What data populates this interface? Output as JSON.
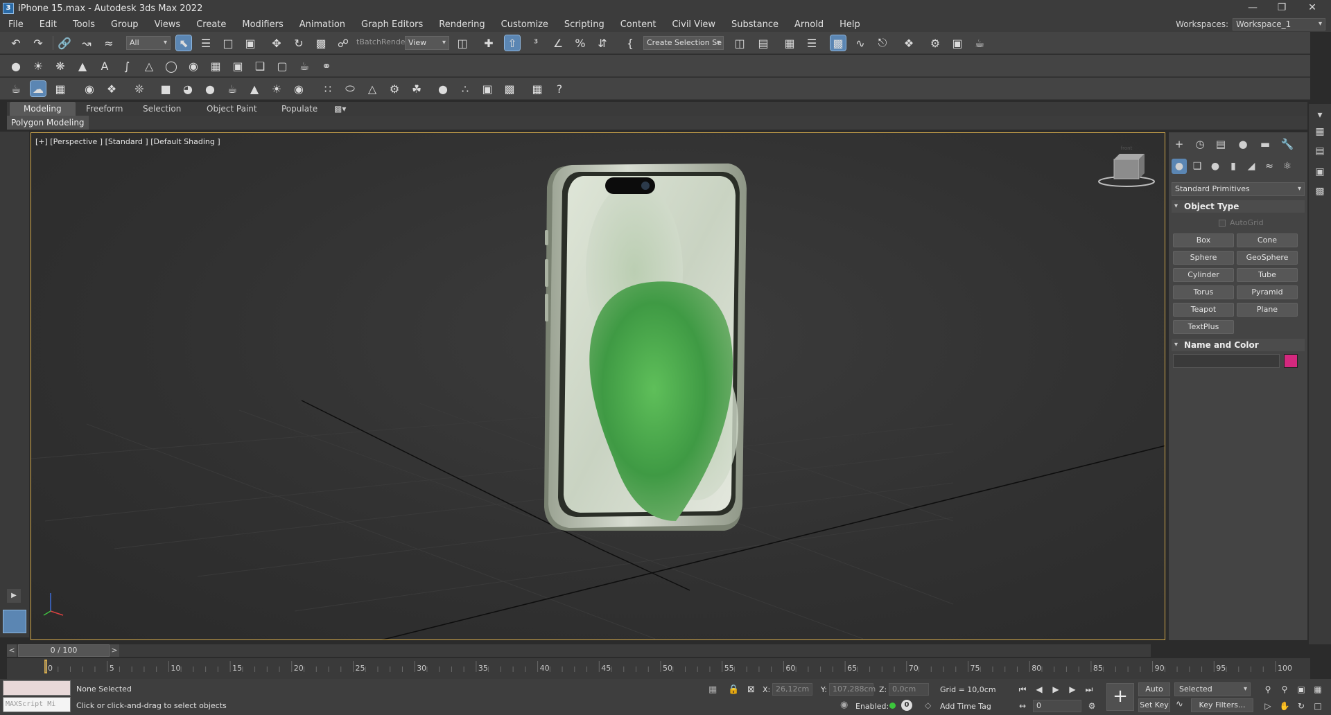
{
  "window": {
    "title": "iPhone 15.max - Autodesk 3ds Max 2022",
    "app_icon_glyph": "3",
    "controls": [
      "minimize-icon",
      "restore-icon",
      "close-icon"
    ]
  },
  "menu": {
    "items": [
      "File",
      "Edit",
      "Tools",
      "Group",
      "Views",
      "Create",
      "Modifiers",
      "Animation",
      "Graph Editors",
      "Rendering",
      "Customize",
      "Scripting",
      "Content",
      "Civil View",
      "Substance",
      "Arnold",
      "Help"
    ],
    "workspace_label": "Workspaces:",
    "workspace_value": "Workspace_1"
  },
  "toolbar_main": {
    "selection_filter": "All",
    "batch_render_label": "tBatchRender",
    "coord_system": "View",
    "named_selection_placeholder": "Create Selection Se"
  },
  "ribbon": {
    "tabs": [
      "Modeling",
      "Freeform",
      "Selection",
      "Object Paint",
      "Populate"
    ],
    "active_tab": "Modeling",
    "panel_label": "Polygon Modeling"
  },
  "viewport": {
    "label": "[+] [Perspective ] [Standard ] [Default Shading ]",
    "viewcube_label": "front",
    "border_color": "#d4aa4c"
  },
  "command_panel": {
    "category": "Standard Primitives",
    "object_type_title": "Object Type",
    "autogrid_label": "AutoGrid",
    "primitives": [
      "Box",
      "Cone",
      "Sphere",
      "GeoSphere",
      "Cylinder",
      "Tube",
      "Torus",
      "Pyramid",
      "Teapot",
      "Plane",
      "TextPlus"
    ],
    "name_color_title": "Name and Color",
    "swatch_color": "#d4287e"
  },
  "timeline": {
    "frame_display": "0 / 100",
    "prev_label": "<",
    "next_label": ">",
    "ticks": [
      "0",
      "5",
      "10",
      "15",
      "20",
      "25",
      "30",
      "35",
      "40",
      "45",
      "50",
      "55",
      "60",
      "65",
      "70",
      "75",
      "80",
      "85",
      "90",
      "95",
      "100"
    ]
  },
  "status": {
    "selection": "None Selected",
    "prompt": "Click or click-and-drag to select objects",
    "maxscript_placeholder": "MAXScript Mi",
    "x_label": "X:",
    "x_value": "26,12cm",
    "y_label": "Y:",
    "y_value": "107,288cm",
    "z_label": "Z:",
    "z_value": "0,0cm",
    "grid": "Grid = 10,0cm",
    "enabled_label": "Enabled:",
    "add_time_tag": "Add Time Tag",
    "current_frame": "0",
    "auto_key": "Auto Key",
    "set_key": "Set Key",
    "key_mode": "Selected",
    "key_filters": "Key Filters..."
  }
}
